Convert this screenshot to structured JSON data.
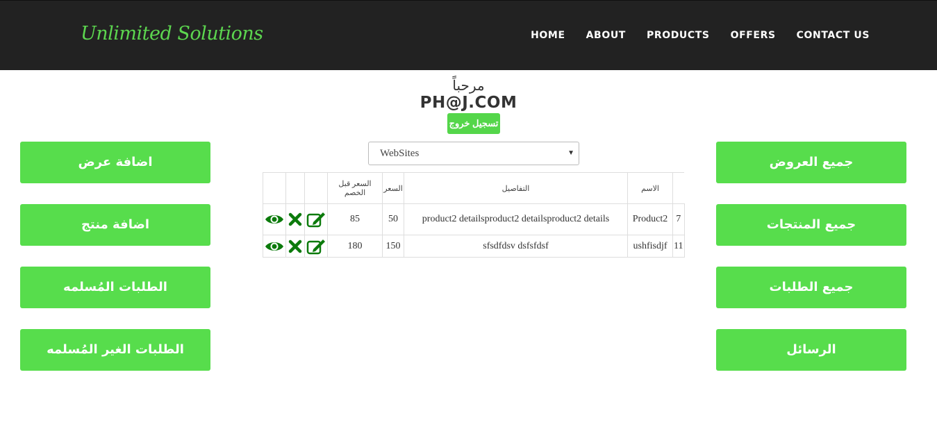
{
  "brand": "Unlimited Solutions",
  "nav": [
    "HOME",
    "ABOUT",
    "PRODUCTS",
    "OFFERS",
    "CONTACT US"
  ],
  "welcome": "مرحباً",
  "user_email": "PH@J.COM",
  "logout_label": "تسجيل خروج",
  "left_buttons": [
    "اضافة عرض",
    "اضافة منتج",
    "الطلبات المُسلمه",
    "الطلبات الغير المُسلمه"
  ],
  "right_buttons": [
    "جميع العروض",
    "جميع المنتجات",
    "جميع الطلبات",
    "الرسائل"
  ],
  "category_select": "WebSites",
  "table": {
    "headers": {
      "name": "الاسم",
      "details": "التفاصيل",
      "price": "السعر",
      "price_before": "السعر قبل الخصم"
    },
    "rows": [
      {
        "id": "7",
        "name": "Product2",
        "details": "product2 detailsproduct2 detailsproduct2 details",
        "price": "50",
        "price_before": "85"
      },
      {
        "id": "11",
        "name": "ushfisdjf",
        "details": "sfsdfdsv dsfsfdsf",
        "price": "150",
        "price_before": "180"
      }
    ]
  },
  "colors": {
    "accent": "#57dd4c",
    "navbar": "#222222",
    "icon_green": "#0b7a0b"
  },
  "icons": [
    "view-icon",
    "delete-icon",
    "edit-icon"
  ]
}
